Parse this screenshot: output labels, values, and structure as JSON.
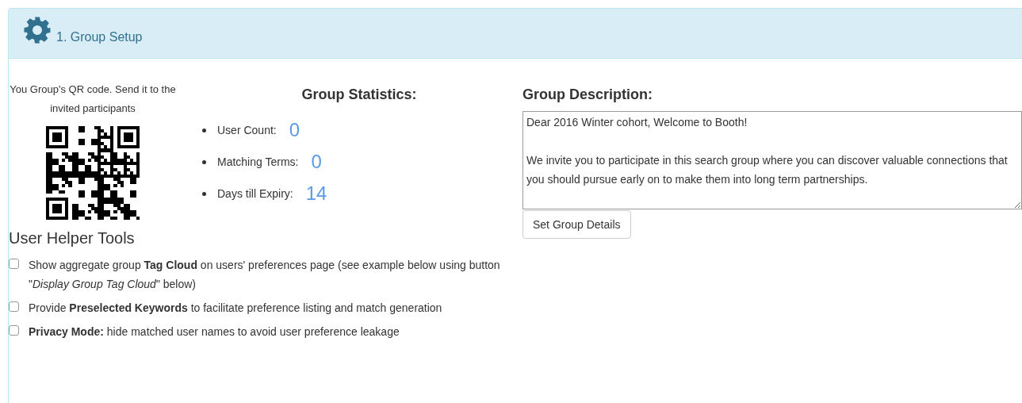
{
  "panel": {
    "title": "1. Group Setup"
  },
  "qr": {
    "caption": "You Group's QR code. Send it to the invited participants"
  },
  "statistics": {
    "heading": "Group Statistics:",
    "items": [
      {
        "label": "User Count:",
        "value": "0"
      },
      {
        "label": "Matching Terms:",
        "value": "0"
      },
      {
        "label": "Days till Expiry:",
        "value": "14"
      }
    ]
  },
  "description": {
    "heading": "Group Description:",
    "value": "Dear 2016 Winter cohort, Welcome to Booth!\n\nWe invite you to participate in this search group where you can discover valuable connections that you should pursue early on to make them into long term partnerships.",
    "button": "Set Group Details"
  },
  "helper_tools": {
    "heading": "User Helper Tools",
    "options": [
      {
        "text": "Show aggregate group **Tag Cloud** on users' preferences page (see example below using button \"*Display Group Tag Cloud*\" below)",
        "checked": false
      },
      {
        "text": "Provide **Preselected Keywords** to facilitate preference listing and match generation",
        "checked": false
      },
      {
        "text": "**Privacy Mode:** hide matched user names to avoid user preference leakage",
        "checked": false
      }
    ]
  }
}
